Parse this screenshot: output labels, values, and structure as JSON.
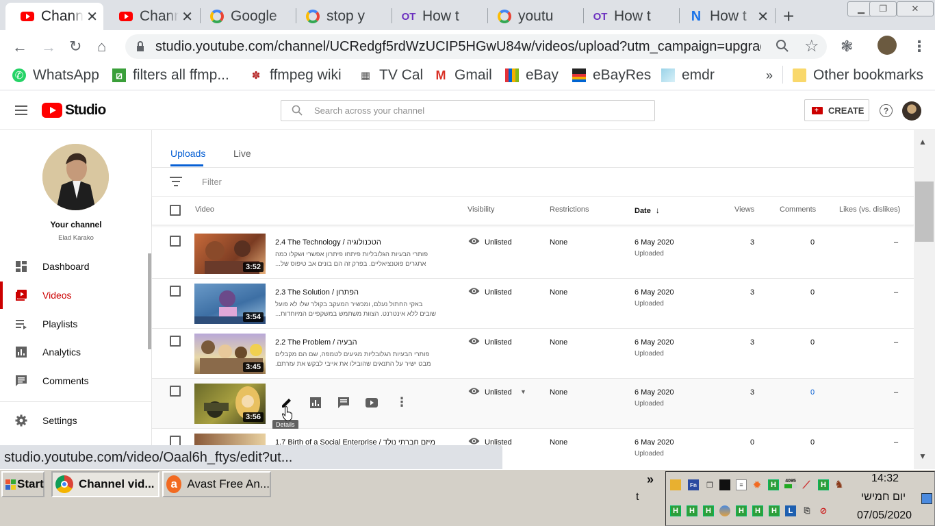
{
  "browser": {
    "tabs": [
      {
        "title": "Chann",
        "favicon": "youtube-icon",
        "active": true
      },
      {
        "title": "Chann",
        "favicon": "youtube-icon"
      },
      {
        "title": "Google",
        "favicon": "google-icon"
      },
      {
        "title": "stop y",
        "favicon": "google-icon"
      },
      {
        "title": "How t",
        "favicon": "ot-icon"
      },
      {
        "title": "youtu",
        "favicon": "google-icon"
      },
      {
        "title": "How t",
        "favicon": "ot-icon"
      },
      {
        "title": "How t",
        "favicon": "n-icon"
      }
    ],
    "url": "studio.youtube.com/channel/UCRedgf5rdWzUCIP5HGwU84w/videos/upload?utm_campaign=upgrade&utm_...",
    "bookmarks": [
      {
        "label": "WhatsApp",
        "icon": "whatsapp-icon"
      },
      {
        "label": "filters all ffmp...",
        "icon": "ffmpeg-icon"
      },
      {
        "label": "ffmpeg wiki",
        "icon": "paw-icon"
      },
      {
        "label": "TV Cal",
        "icon": "tv-icon"
      },
      {
        "label": "Gmail",
        "icon": "gmail-icon"
      },
      {
        "label": "eBay",
        "icon": "ebay-icon"
      },
      {
        "label": "eBayRes",
        "icon": "ebay-bag-icon"
      },
      {
        "label": "emdr",
        "icon": "emdr-icon"
      }
    ],
    "bookmarks_overflow": "»",
    "other_bookmarks": "Other bookmarks",
    "status_url": "studio.youtube.com/video/Oaal6h_ftys/edit?ut..."
  },
  "studio": {
    "logo_text": "Studio",
    "search_placeholder": "Search across your channel",
    "create_label": "CREATE",
    "channel": {
      "title": "Your channel",
      "name": "Elad Karako"
    },
    "nav": [
      {
        "label": "Dashboard",
        "icon": "dashboard-icon"
      },
      {
        "label": "Videos",
        "icon": "videos-icon",
        "active": true
      },
      {
        "label": "Playlists",
        "icon": "playlists-icon"
      },
      {
        "label": "Analytics",
        "icon": "analytics-icon"
      },
      {
        "label": "Comments",
        "icon": "comments-icon"
      },
      {
        "label": "Settings",
        "icon": "settings-icon"
      }
    ],
    "tabs": [
      {
        "label": "Uploads",
        "active": true
      },
      {
        "label": "Live"
      }
    ],
    "filter_placeholder": "Filter",
    "columns": {
      "video": "Video",
      "visibility": "Visibility",
      "restrictions": "Restrictions",
      "date": "Date",
      "views": "Views",
      "comments": "Comments",
      "likes": "Likes (vs. dislikes)"
    },
    "videos": [
      {
        "title": "2.4 The Technology / הטכנולוגיה",
        "desc1": "פותרי הבעיות הגלובליות פיתחו פיתרון אפשרי ושקלו כמה",
        "desc2": "אתגרים פוטנציאליים. בפרק זה הם בונים אב טיפוס של...",
        "duration": "3:52",
        "visibility": "Unlisted",
        "restrictions": "None",
        "date": "6 May 2020",
        "status": "Uploaded",
        "views": "3",
        "comments": "0",
        "likes": "–"
      },
      {
        "title": "2.3 The Solution / הפתרון",
        "desc1": "באקי החתול נעלם, ומכשיר המעקב בקולר שלו לא פועל",
        "desc2": "שובים ללא אינטרנט. הצוות משתמש במשקפיים המיוחדות...",
        "duration": "3:54",
        "visibility": "Unlisted",
        "restrictions": "None",
        "date": "6 May 2020",
        "status": "Uploaded",
        "views": "3",
        "comments": "0",
        "likes": "–"
      },
      {
        "title": "2.2 The Problem / הבעיה",
        "desc1": "פותרי הבעיות הגלובליות מגיעים לטמפה, שם הם מקבלים",
        "desc2": "מבט ישיר על התנאים שהובילו את אייבי לבקש את עזרתם.",
        "duration": "3:45",
        "visibility": "Unlisted",
        "restrictions": "None",
        "date": "6 May 2020",
        "status": "Uploaded",
        "views": "3",
        "comments": "0",
        "likes": "–"
      },
      {
        "title": "",
        "desc1": "",
        "desc2": "",
        "duration": "3:56",
        "visibility": "Unlisted",
        "restrictions": "None",
        "date": "6 May 2020",
        "status": "Uploaded",
        "views": "3",
        "comments": "0",
        "likes": "–",
        "hovered": true,
        "tooltip": "Details"
      },
      {
        "title": "1.7 Birth of a Social Enterprise / מיזם חברתי נולד",
        "desc1": "",
        "desc2": "",
        "duration": "",
        "visibility": "Unlisted",
        "restrictions": "None",
        "date": "6 May 2020",
        "status": "Uploaded",
        "views": "0",
        "comments": "0",
        "likes": "–"
      }
    ]
  },
  "taskbar": {
    "start_label": "Start",
    "buttons": [
      {
        "label": "Channel vid...",
        "icon": "chrome-icon",
        "active": true
      },
      {
        "label": "Avast Free An...",
        "icon": "avast-icon"
      }
    ],
    "overflow": "»",
    "lone_char": "t",
    "clock": {
      "time": "14:32",
      "day": "יום חמישי",
      "date": "07/05/2020"
    },
    "tray_number": "4095"
  },
  "colors": {
    "youtube_red": "#ff0000",
    "active_red": "#cc0000",
    "link_blue": "#065fd4",
    "taskbar": "#d4d0c8"
  }
}
